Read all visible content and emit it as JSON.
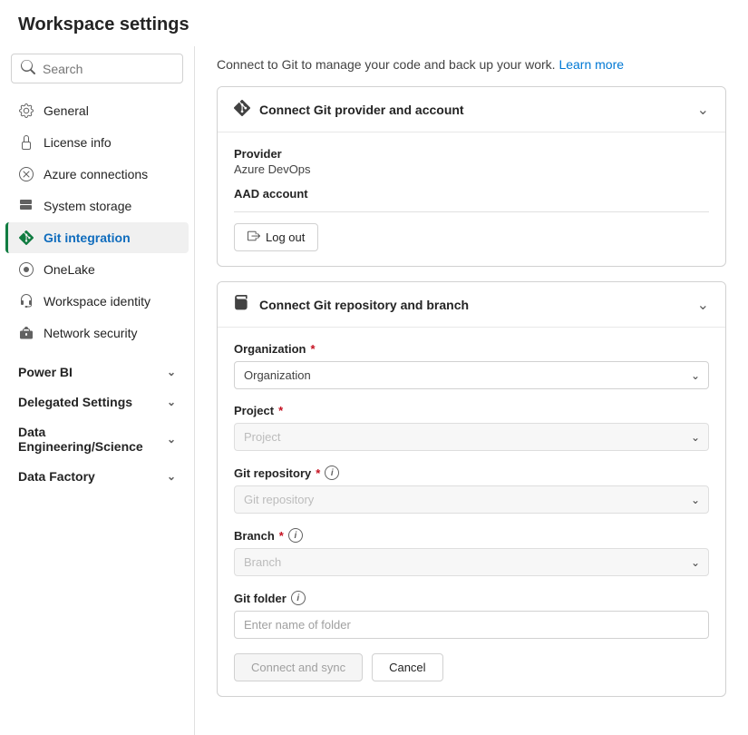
{
  "page": {
    "title": "Workspace settings"
  },
  "sidebar": {
    "search_placeholder": "Search",
    "items": [
      {
        "id": "general",
        "label": "General",
        "icon": "⚙",
        "active": false
      },
      {
        "id": "license-info",
        "label": "License info",
        "icon": "◇",
        "active": false
      },
      {
        "id": "azure-connections",
        "label": "Azure connections",
        "icon": "◈",
        "active": false
      },
      {
        "id": "system-storage",
        "label": "System storage",
        "icon": "▦",
        "active": false
      },
      {
        "id": "git-integration",
        "label": "Git integration",
        "icon": "◆",
        "active": true
      },
      {
        "id": "onelake",
        "label": "OneLake",
        "icon": "○",
        "active": false
      },
      {
        "id": "workspace-identity",
        "label": "Workspace identity",
        "icon": "☁",
        "active": false
      },
      {
        "id": "network-security",
        "label": "Network security",
        "icon": "⊡",
        "active": false
      }
    ],
    "sections": [
      {
        "id": "power-bi",
        "label": "Power BI",
        "collapsed": true
      },
      {
        "id": "delegated-settings",
        "label": "Delegated Settings",
        "collapsed": true
      },
      {
        "id": "data-engineering-science",
        "label": "Data Engineering/Science",
        "collapsed": true
      },
      {
        "id": "data-factory",
        "label": "Data Factory",
        "collapsed": true
      }
    ]
  },
  "panel": {
    "description": "Connect to Git to manage your code and back up your work.",
    "learn_more": "Learn more",
    "card1": {
      "title": "Connect Git provider and account",
      "provider_label": "Provider",
      "provider_value": "Azure DevOps",
      "aad_label": "AAD account",
      "aad_value": "",
      "logout_btn": "Log out",
      "logout_icon": "⎋"
    },
    "card2": {
      "title": "Connect Git repository and branch",
      "organization_label": "Organization",
      "organization_required": true,
      "organization_placeholder": "Organization",
      "project_label": "Project",
      "project_required": true,
      "project_placeholder": "Project",
      "git_repository_label": "Git repository",
      "git_repository_required": true,
      "git_repository_placeholder": "Git repository",
      "branch_label": "Branch",
      "branch_required": true,
      "branch_placeholder": "Branch",
      "git_folder_label": "Git folder",
      "git_folder_placeholder": "Enter name of folder",
      "connect_btn": "Connect and sync",
      "cancel_btn": "Cancel"
    }
  }
}
